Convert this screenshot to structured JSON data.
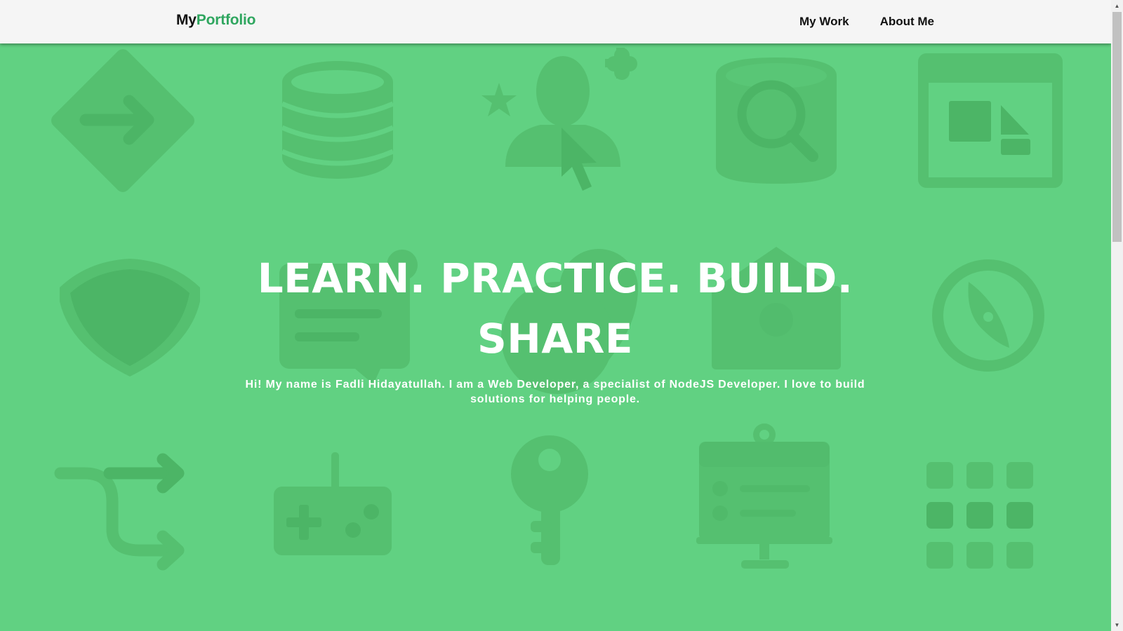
{
  "navbar": {
    "brand_prefix": "My",
    "brand_accent": "Portfolio",
    "links": [
      {
        "label": "My Work"
      },
      {
        "label": "About Me"
      }
    ]
  },
  "hero": {
    "title": "LEARN. PRACTICE. BUILD. SHARE",
    "subtitle": "Hi! My name is Fadli Hidayatullah. I am a Web Developer, a specialist of NodeJS Developer. I love to build solutions for helping people."
  },
  "background_icons": [
    "diamond-arrow-icon",
    "database-icon",
    "user-cursor-icon",
    "search-bucket-icon",
    "browser-window-icon",
    "shield-icon",
    "chat-bubble-icon",
    "map-pin-icon",
    "envelope-icon",
    "compass-icon",
    "route-arrows-icon",
    "gamepad-icon",
    "key-icon",
    "presentation-board-icon",
    "grid-apps-icon"
  ],
  "colors": {
    "background": "#61d182",
    "icon": "#55c070",
    "icon_dark": "#4cb566",
    "navbar": "#f5f5f5",
    "brand_accent": "#2fa65f",
    "text_dark": "#111111",
    "text_light": "#ffffff"
  }
}
